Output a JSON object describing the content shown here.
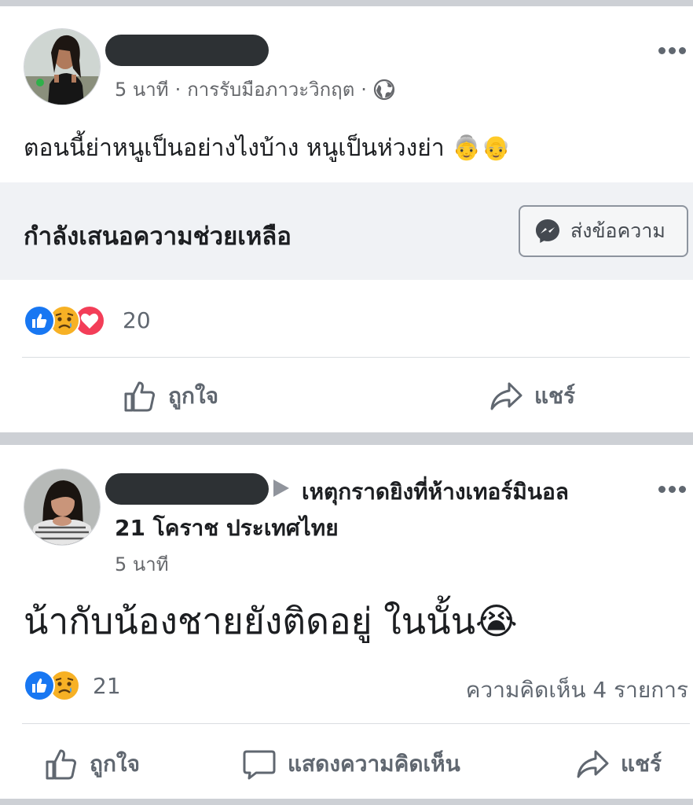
{
  "post1": {
    "meta": {
      "time": "5 นาที",
      "dot": "·",
      "context": "การรับมือภาวะวิกฤต",
      "dot2": "·"
    },
    "text": "ตอนนี้ย่าหนูเป็นอย่างไงบ้าง หนูเป็นห่วงย่า",
    "emoji": "👵👴",
    "offer_help": {
      "label": "กำลังเสนอความช่วยเหลือ",
      "button": "ส่งข้อความ"
    },
    "reactions": {
      "count": "20",
      "icons": [
        "like-icon",
        "sad-icon",
        "love-icon"
      ]
    },
    "actions": {
      "like": "ถูกใจ",
      "share": "แชร์"
    }
  },
  "post2": {
    "target": "เหตุกราดยิงที่ห้างเทอร์มินอล",
    "target_line2": "21 โคราช ประเทศไทย",
    "time": "5 นาที",
    "text": "น้ากับน้องชายยังติดอยู่ ในนั้น",
    "emoji": "😭",
    "reactions": {
      "count": "21",
      "icons": [
        "like-icon",
        "sad-icon"
      ]
    },
    "comments": "ความคิดเห็น 4 รายการ",
    "actions": {
      "like": "ถูกใจ",
      "comment": "แสดงความคิดเห็น",
      "share": "แชร์"
    }
  },
  "colors": {
    "accent": "#1877f2",
    "love": "#f33e58",
    "sad": "#f7b125",
    "separator": "#cdd0d5",
    "panel": "#f0f2f5"
  }
}
